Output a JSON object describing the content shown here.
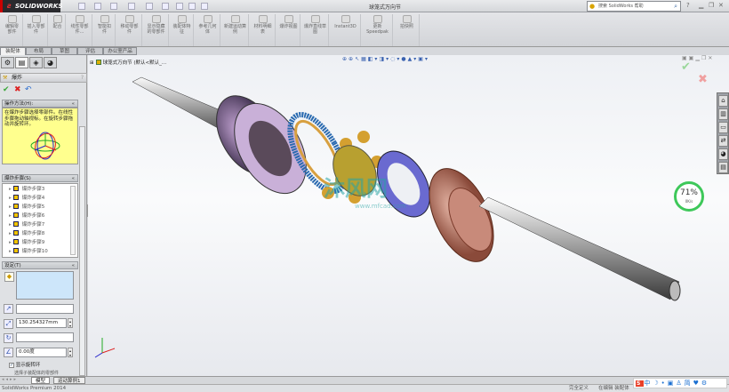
{
  "app": {
    "brand": "SOLIDWORKS",
    "document_title": "球笼式万向节",
    "window_controls": [
      "minimize",
      "restore",
      "close"
    ]
  },
  "quick_access": [
    "new-icon",
    "open-icon",
    "save-icon",
    "print-icon",
    "undo-icon",
    "select-icon",
    "rebuild-icon",
    "file-properties-icon",
    "options-icon"
  ],
  "search": {
    "placeholder": "搜索 SolidWorks 帮助"
  },
  "ribbon": [
    {
      "label": "编辑零部件"
    },
    {
      "label": "插入零部件"
    },
    {
      "label": "配合"
    },
    {
      "label": "线性零部件..."
    },
    {
      "label": "智能扣件"
    },
    {
      "label": "移动零部件"
    },
    {
      "label": "显示隐藏的零部件"
    },
    {
      "label": "装配体特征"
    },
    {
      "label": "参考几何体"
    },
    {
      "label": "新建运动算例"
    },
    {
      "label": "材料明细表"
    },
    {
      "label": "爆炸视图"
    },
    {
      "label": "爆炸直线草图"
    },
    {
      "label": "Instant3D"
    },
    {
      "label": "更新Speedpak"
    },
    {
      "label": "拍快照"
    }
  ],
  "tabs": [
    {
      "label": "装配体",
      "active": true
    },
    {
      "label": "布局"
    },
    {
      "label": "草图"
    },
    {
      "label": "评估"
    },
    {
      "label": "办公室产品"
    }
  ],
  "panel": {
    "title": "爆炸",
    "help": "?",
    "howto": {
      "header": "操作方法(H):",
      "text": "在爆炸步骤选择零部件。在线性步骤拖动轴视标。在旋转步骤拖动并旋转环。"
    },
    "steps": {
      "header": "爆炸步骤(S)",
      "items": [
        "爆炸步骤3",
        "爆炸步骤4",
        "爆炸步骤5",
        "爆炸步骤6",
        "爆炸步骤7",
        "爆炸步骤8",
        "爆炸步骤9",
        "爆炸步骤10"
      ]
    },
    "settings": {
      "header": "设定(T)",
      "distance": "130.254327mm",
      "angle": "0.00度",
      "show_ring_label": "显示旋转环",
      "show_ring_checked": true,
      "cut_text": "选择子装配体的零部件"
    }
  },
  "viewport": {
    "tree_root": "球笼式万向节",
    "tree_config": "(默认<默认_..."
  },
  "watermark": {
    "text": "沐风网",
    "url": "www.mfcad.com"
  },
  "gauge": {
    "percent": 71,
    "label": "71%",
    "speed": "0K/s"
  },
  "bottom_tabs": [
    {
      "label": "模型",
      "active": true
    },
    {
      "label": "运动算例1"
    }
  ],
  "status": {
    "product": "SolidWorks Premium 2014",
    "state": "完全定义",
    "mode": "在编辑 装配体"
  },
  "ime": {
    "label": "中"
  },
  "colors": {
    "accent": "#2f6fcf",
    "howto_bg": "#ffff8e",
    "gauge": "#3ec85a",
    "cancel": "#e05050",
    "ok": "#3aa83a"
  }
}
